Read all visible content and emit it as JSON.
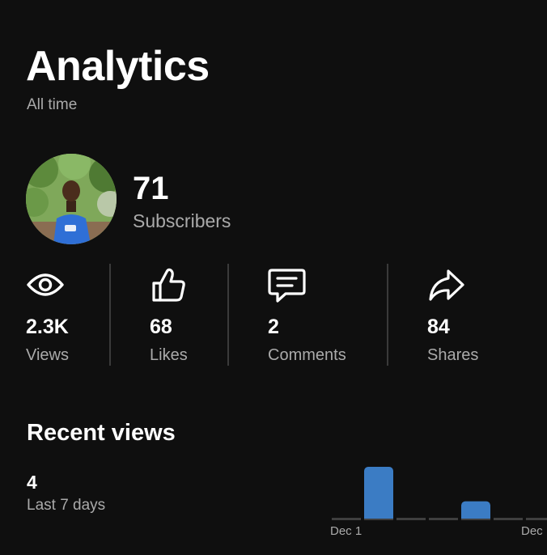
{
  "header": {
    "title": "Analytics",
    "subtitle": "All time"
  },
  "channel": {
    "subscribers_count": "71",
    "subscribers_label": "Subscribers"
  },
  "stats": [
    {
      "icon": "eye-icon",
      "value": "2.3K",
      "label": "Views"
    },
    {
      "icon": "thumbs-up-icon",
      "value": "68",
      "label": "Likes"
    },
    {
      "icon": "comment-icon",
      "value": "2",
      "label": "Comments"
    },
    {
      "icon": "share-icon",
      "value": "84",
      "label": "Shares"
    }
  ],
  "recent": {
    "title": "Recent views",
    "count": "4",
    "period_label": "Last 7 days"
  },
  "colors": {
    "background": "#0f0f0f",
    "bar": "#3b7cc4",
    "baseline": "#3f3f3f",
    "secondary_text": "#aaaaaa"
  },
  "chart_data": {
    "type": "bar",
    "categories": [
      "",
      "",
      "",
      "",
      "",
      "",
      ""
    ],
    "values": [
      0,
      3,
      0,
      0,
      1,
      0,
      0
    ],
    "tick_labels": [
      "Dec 1",
      "Dec"
    ],
    "ylim": [
      0,
      3
    ]
  }
}
